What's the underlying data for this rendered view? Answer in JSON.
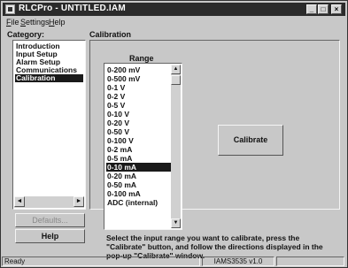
{
  "window": {
    "title": "RLCPro - UNTITLED.IAM",
    "min": "_",
    "max": "□",
    "close": "×"
  },
  "menu": [
    {
      "first": "F",
      "rest": "ile"
    },
    {
      "first": "S",
      "rest": "ettings"
    },
    {
      "first": "H",
      "rest": "elp"
    }
  ],
  "category": {
    "label": "Category:",
    "items": [
      "Introduction",
      "Input Setup",
      "Alarm Setup",
      "Communications",
      "Calibration"
    ],
    "selected": "Calibration",
    "left_arrow": "◄",
    "right_arrow": "►"
  },
  "buttons": {
    "defaults": "Defaults...",
    "help": "Help",
    "calibrate": "Calibrate"
  },
  "calibration": {
    "label": "Calibration",
    "range_label": "Range",
    "ranges": [
      "0-200 mV",
      "0-500 mV",
      "0-1 V",
      "0-2 V",
      "0-5 V",
      "0-10 V",
      "0-20 V",
      "0-50 V",
      "0-100 V",
      "0-2 mA",
      "0-5 mA",
      "0-10 mA",
      "0-20 mA",
      "0-50 mA",
      "0-100 mA",
      "ADC (internal)"
    ],
    "selected": "0-10 mA",
    "up_arrow": "▲",
    "down_arrow": "▼",
    "instructions": "Select the input range you want to calibrate, press the \"Calibrate\" button, and follow the directions displayed in the pop-up \"Calibrate\" window."
  },
  "status": {
    "left": "Ready",
    "right": "IAMS3535 v1.0"
  }
}
